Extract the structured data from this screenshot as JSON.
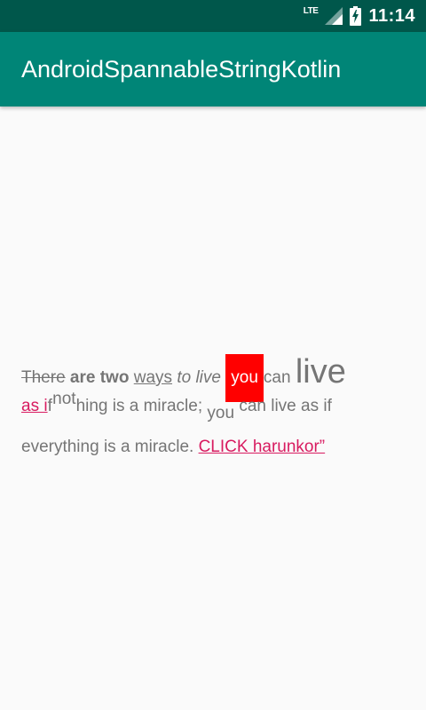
{
  "status_bar": {
    "network": "LTE",
    "time": "11:14"
  },
  "app_bar": {
    "title": "AndroidSpannableStringKotlin"
  },
  "spannable_text": {
    "line1": {
      "there": "There",
      "are_two": "are two",
      "ways": "ways",
      "to": "to",
      "live": "live",
      "you": "you",
      "can": "can",
      "live_big": "live"
    },
    "line2": {
      "as_i": "as i",
      "f": "f",
      "not": "not",
      "hing": "hing is a miracle;",
      "you": "you",
      "rest": "can live as if"
    },
    "line3": {
      "text": "everything is a miracle.",
      "link": "CLICK harunkor”"
    }
  },
  "colors": {
    "status_bar": "#00574b",
    "app_bar": "#008577",
    "highlight": "#ff0000",
    "link": "#d81b60",
    "body_text": "#757575"
  }
}
